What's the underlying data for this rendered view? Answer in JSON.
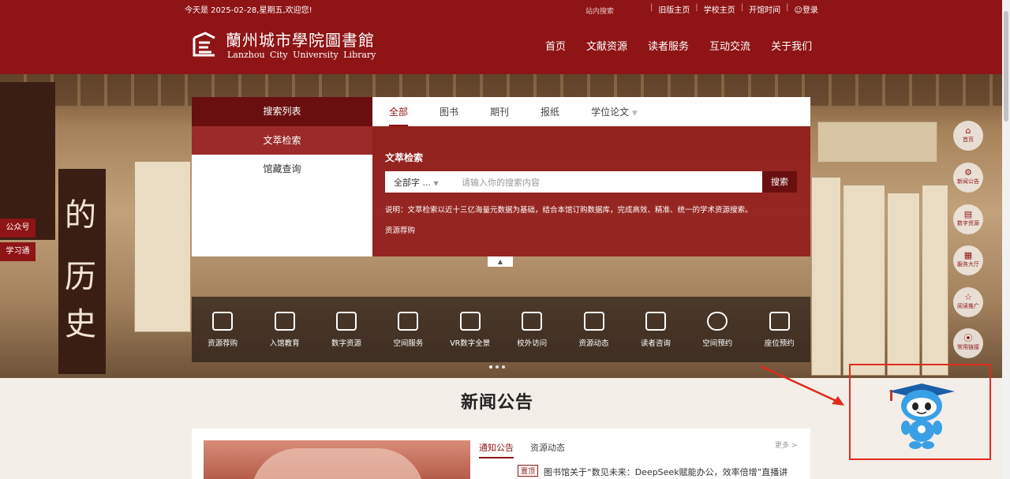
{
  "header": {
    "welcome": "今天是 2025-02-28,星期五,欢迎您!",
    "site_search": "站内搜索",
    "links": [
      "旧版主页",
      "学校主页",
      "开馆时间",
      "登录"
    ],
    "logo_cn": "蘭州城市學院圖書館",
    "logo_en": "Lanzhou City University Library",
    "nav": [
      "首页",
      "文献资源",
      "读者服务",
      "互动交流",
      "关于我们"
    ]
  },
  "hero": {
    "ink_chars": [
      "的",
      "历",
      "史"
    ]
  },
  "side_tags": [
    "公众号",
    "学习通"
  ],
  "search": {
    "left_title": "搜索列表",
    "left_items": [
      "文萃检索",
      "馆藏查询"
    ],
    "tabs": [
      "全部",
      "图书",
      "期刊",
      "报纸",
      "学位论文"
    ],
    "section_title": "文萃检索",
    "select_value": "全部字 ...",
    "placeholder": "请输入你的搜索内容",
    "button": "搜索",
    "note": "说明：文萃检索以近十三亿海量元数据为基础，结合本馆订购数据库，完成高效、精准、统一的学术资源搜索。",
    "link": "资源荐购"
  },
  "quick_links": [
    "资源荐购",
    "入馆教育",
    "数字资源",
    "空间服务",
    "VR数字全景",
    "校外访问",
    "资源动态",
    "读者咨询",
    "空间预约",
    "座位预约"
  ],
  "right_float": [
    {
      "label": "首页",
      "icon": "home-icon"
    },
    {
      "label": "新闻公告",
      "icon": "gear-icon"
    },
    {
      "label": "数字资源",
      "icon": "book-icon"
    },
    {
      "label": "服务大厅",
      "icon": "grid-icon"
    },
    {
      "label": "阅读推广",
      "icon": "star-icon"
    },
    {
      "label": "常用链接",
      "icon": "compass-icon"
    }
  ],
  "news": {
    "title": "新闻公告",
    "tabs": [
      "通知公告",
      "资源动态"
    ],
    "more": "更多 >",
    "badge": "置顶",
    "headline": "图书馆关于“数见未来：DeepSeek赋能办公，效率倍增”直播讲"
  },
  "colors": {
    "brand": "#8e1416",
    "brand_dark": "#6a0f10",
    "annotation": "#e02b1d"
  }
}
